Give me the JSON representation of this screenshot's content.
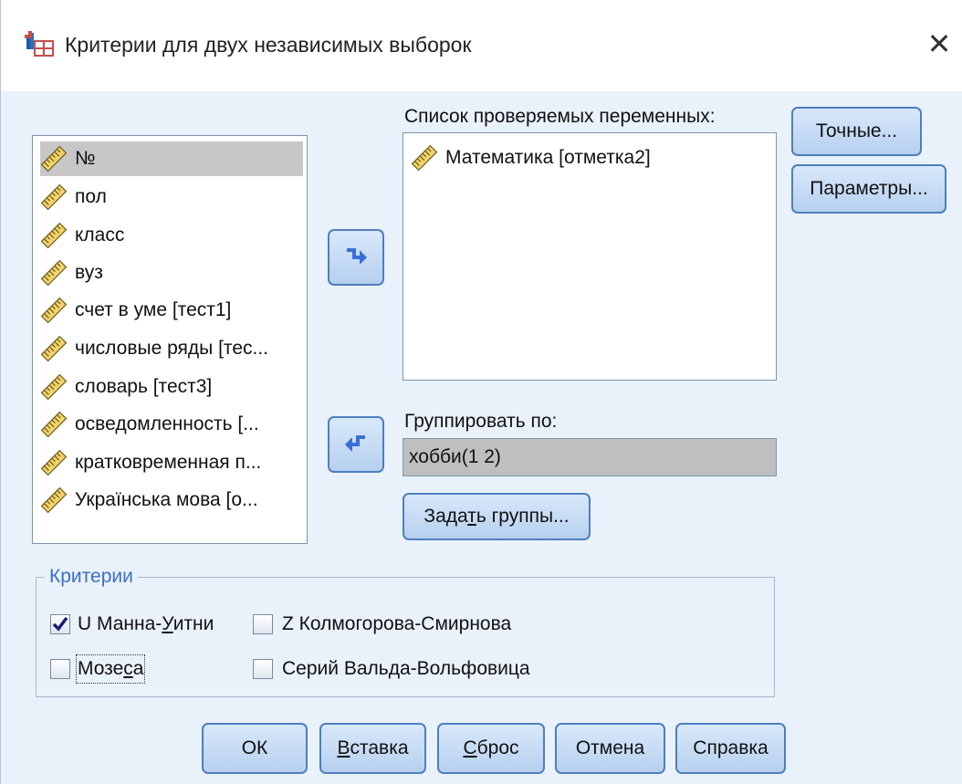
{
  "window": {
    "title": "Критерии для двух независимых выборок",
    "close_glyph": "✕"
  },
  "source_list": {
    "items": [
      {
        "label": "№",
        "selected": true
      },
      {
        "label": "пол"
      },
      {
        "label": "класс"
      },
      {
        "label": "вуз"
      },
      {
        "label": "счет в уме [тест1]"
      },
      {
        "label": "числовые ряды [тес..."
      },
      {
        "label": "словарь [тест3]"
      },
      {
        "label": "осведомленность [..."
      },
      {
        "label": "кратковременная п..."
      },
      {
        "label": "Українська мова [о..."
      }
    ],
    "item_icon": "scale-ruler-icon"
  },
  "test_variables": {
    "label": "Список проверяемых переменных:",
    "items": [
      {
        "label": "Математика [отметка2]"
      }
    ]
  },
  "grouping": {
    "label": "Группировать по:",
    "value": "хобби(1 2)",
    "define_groups_button": {
      "before": "Зада",
      "mnemonic": "т",
      "after": "ь группы..."
    }
  },
  "side_buttons": {
    "exact": "Точные...",
    "options": "Параметры..."
  },
  "tests": {
    "legend": "Критерии",
    "mann_whitney": {
      "before": "U Манна-",
      "mnemonic": "У",
      "after": "итни",
      "checked": true
    },
    "kolmogorov_smirnov": {
      "label": "Z Колмогорова-Смирнова",
      "checked": false
    },
    "moses": {
      "before": "Мозе",
      "mnemonic": "с",
      "after": "а",
      "checked": false
    },
    "wald_wolfowitz": {
      "label": "Серий Вальда-Вольфовица",
      "checked": false
    }
  },
  "footer_buttons": {
    "ok": "ОК",
    "paste": {
      "mnemonic": "В",
      "after": "ставка"
    },
    "reset": {
      "mnemonic": "С",
      "after": "брос"
    },
    "cancel": "Отмена",
    "help": "Справка"
  },
  "colors": {
    "dialog_background": "#e9f1fb",
    "button_border": "#4e7fbf",
    "legend_text": "#3c6fc3",
    "arrow_icon": "#3a6fd8",
    "selected_row": "#c7c7c7"
  }
}
